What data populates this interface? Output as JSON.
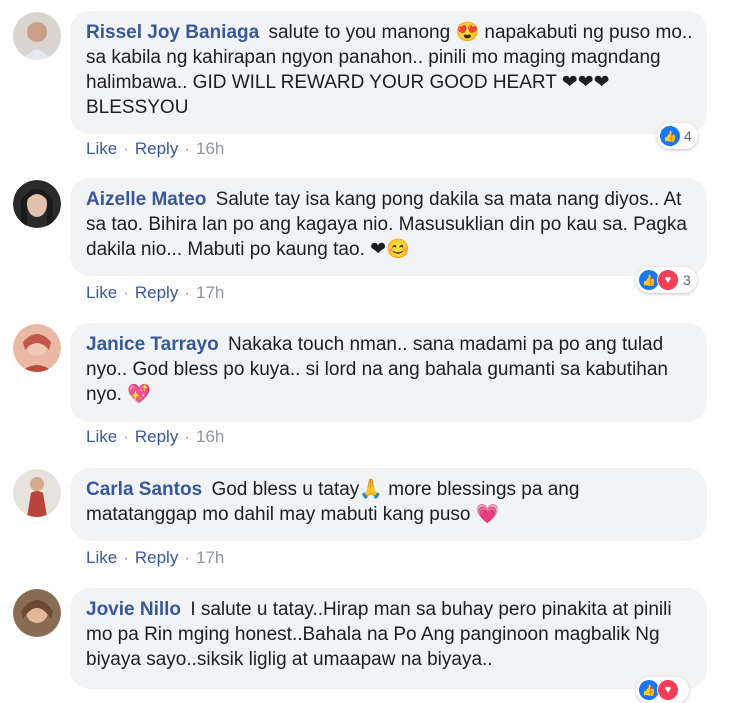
{
  "comments": [
    {
      "author": "Rissel Joy Baniaga",
      "text": "salute to you manong 😍 napakabuti ng puso mo.. sa kabila ng kahirapan ngyon panahon.. pinili mo maging magndang halimbawa.. GID WILL REWARD YOUR GOOD HEART ❤❤❤ BLESSYOU",
      "like": "Like",
      "reply": "Reply",
      "time": "16h",
      "reaction_count": "4"
    },
    {
      "author": "Aizelle Mateo",
      "text": "Salute tay isa kang pong dakila sa mata nang diyos.. At sa tao. Bihira lan po ang kagaya nio. Masusuklian din po kau sa. Pagka dakila nio... Mabuti po kaung tao. ❤😊",
      "like": "Like",
      "reply": "Reply",
      "time": "17h",
      "reaction_count": "3"
    },
    {
      "author": "Janice Tarrayo",
      "text": "Nakaka touch nman.. sana madami pa po ang tulad nyo.. God bless po kuya.. si lord na ang bahala gumanti sa kabutihan nyo. 💖",
      "like": "Like",
      "reply": "Reply",
      "time": "16h"
    },
    {
      "author": "Carla Santos",
      "text": "God bless u tatay🙏 more blessings pa ang matatanggap mo dahil may mabuti kang puso 💗",
      "like": "Like",
      "reply": "Reply",
      "time": "17h"
    },
    {
      "author": "Jovie Nillo",
      "text": "I salute u tatay..Hirap man sa buhay pero pinakita at pinili mo pa Rin mging honest..Bahala na Po Ang panginoon magbalik Ng biyaya sayo..siksik liglig at umaapaw na biyaya.."
    }
  ]
}
